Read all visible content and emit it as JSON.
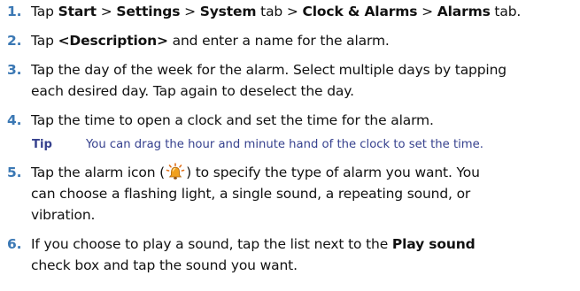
{
  "steps": [
    {
      "number": "1.",
      "parts": [
        {
          "text": "Tap ",
          "bold": false
        },
        {
          "text": "Start",
          "bold": true
        },
        {
          "text": " > ",
          "bold": false
        },
        {
          "text": "Settings",
          "bold": true
        },
        {
          "text": " > ",
          "bold": false
        },
        {
          "text": "System",
          "bold": true
        },
        {
          "text": " tab > ",
          "bold": false
        },
        {
          "text": "Clock & Alarms",
          "bold": true
        },
        {
          "text": " > ",
          "bold": false
        },
        {
          "text": "Alarms",
          "bold": true
        },
        {
          "text": " tab.",
          "bold": false
        }
      ]
    },
    {
      "number": "2.",
      "parts": [
        {
          "text": "Tap ",
          "bold": false
        },
        {
          "text": "<Description>",
          "bold": true
        },
        {
          "text": " and enter a name for the alarm.",
          "bold": false
        }
      ]
    },
    {
      "number": "3.",
      "line1": "Tap the day of the week for the alarm. Select multiple days by tapping",
      "line2": "each desired day. Tap again to deselect the day."
    },
    {
      "number": "4.",
      "text": "Tap the time to open a clock and set the time for the alarm."
    },
    {
      "number": "5.",
      "line1_before_icon": "Tap the alarm icon (",
      "line1_after_icon": ") to specify the type of alarm you want. You",
      "line2": "can choose a flashing light, a single sound, a repeating sound, or",
      "line3": "vibration."
    },
    {
      "number": "6.",
      "line1_before": "If you choose to play a sound, tap the list next to the ",
      "line1_bold": "Play sound",
      "line2": "check box and tap the sound you want."
    }
  ],
  "tip": {
    "label": "Tip",
    "text": "You can drag the hour and minute hand of the clock to set the time."
  },
  "colors": {
    "step_number": "#3b78b4",
    "tip_text": "#36418e",
    "body_text": "#111111",
    "alarm_bell": "#f0a01e",
    "alarm_rays": "#e0701a"
  },
  "icons": {
    "alarm": "alarm-bell-icon"
  }
}
